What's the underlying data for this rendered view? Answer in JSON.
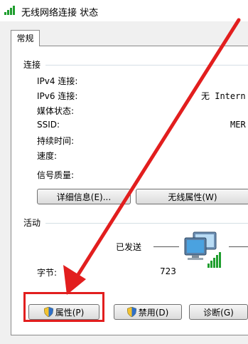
{
  "window": {
    "title": "无线网络连接 状态",
    "icon": "wifi-signal-icon"
  },
  "tabs": [
    {
      "label": "常规"
    }
  ],
  "connection": {
    "section_label": "连接",
    "rows": [
      {
        "label": "IPv4 连接:",
        "value": ""
      },
      {
        "label": "IPv6 连接:",
        "value": "无 Intern"
      },
      {
        "label": "媒体状态:",
        "value": ""
      },
      {
        "label": "SSID:",
        "value": "MER"
      },
      {
        "label": "持续时间:",
        "value": ""
      },
      {
        "label": "速度:",
        "value": ""
      }
    ],
    "signal_label": "信号质量:"
  },
  "buttons": {
    "details": "详细信息(E)...",
    "wireless_props": "无线属性(W)",
    "properties": "属性(P)",
    "disable": "禁用(D)",
    "diagnose": "诊断(G)"
  },
  "activity": {
    "section_label": "活动",
    "sent_label": "已发送",
    "bytes_label": "字节:",
    "bytes_sent": "723"
  },
  "colors": {
    "highlight": "#e21e1e",
    "signal": "#1f9e2e"
  }
}
